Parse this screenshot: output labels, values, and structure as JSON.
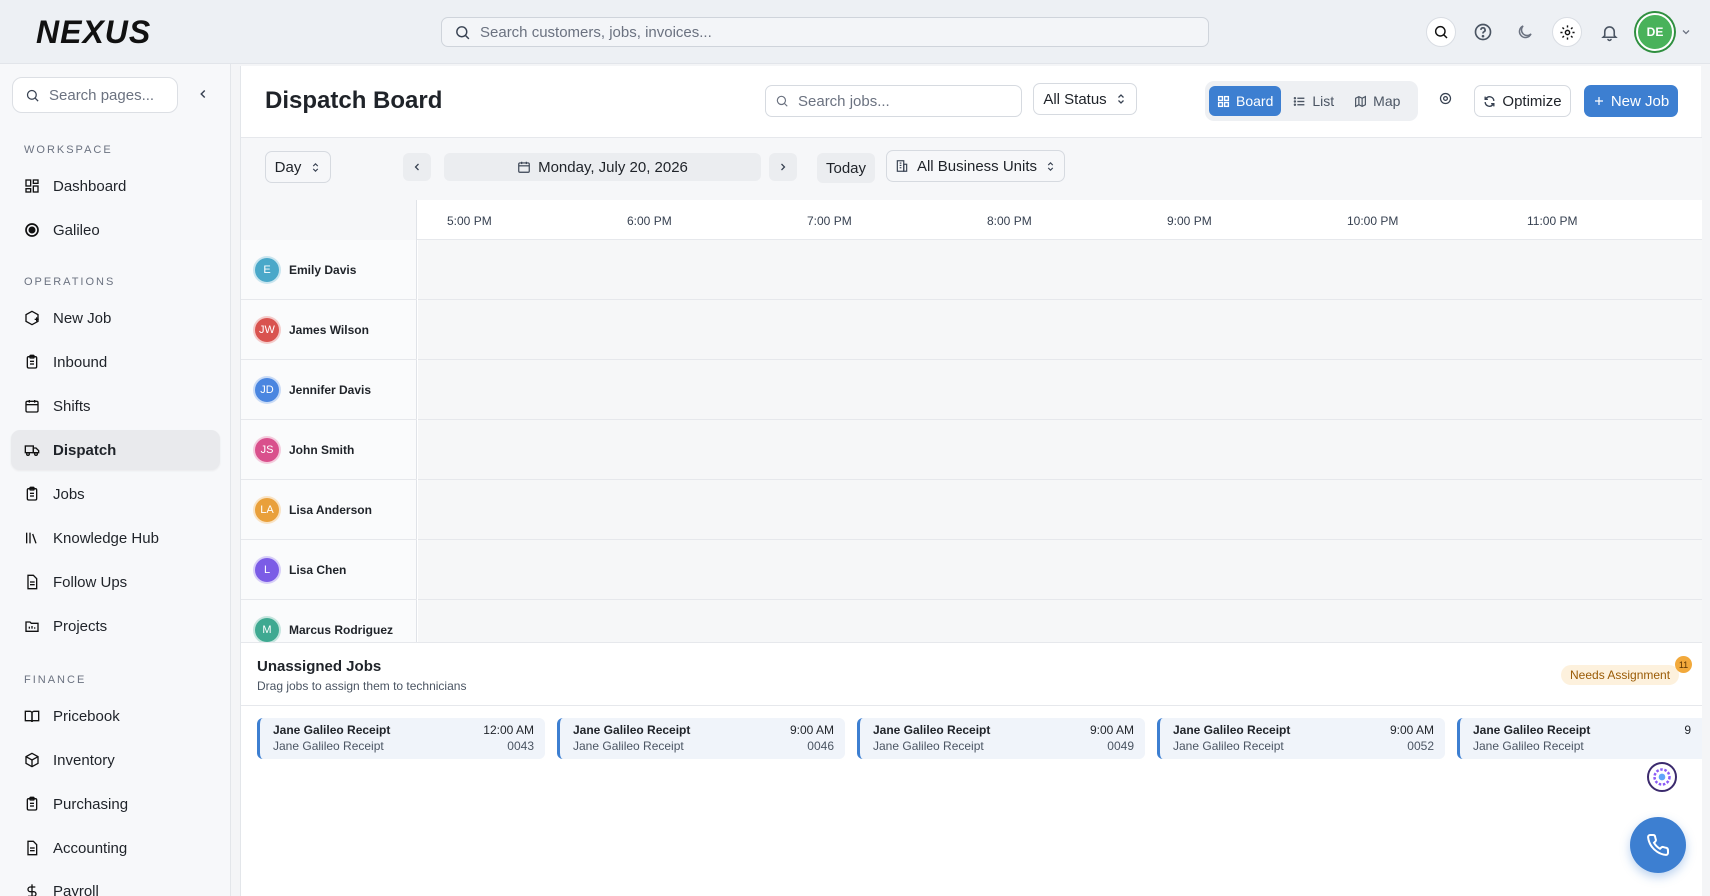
{
  "app": {
    "logo_text": "NEXUS"
  },
  "topbar": {
    "search_placeholder": "Search customers, jobs, invoices...",
    "user_initials": "DE"
  },
  "sidebar": {
    "search_placeholder": "Search pages...",
    "sections": [
      {
        "label": "WORKSPACE",
        "items": [
          {
            "label": "Dashboard",
            "icon": "dashboard-icon"
          },
          {
            "label": "Galileo",
            "icon": "galileo-icon"
          }
        ]
      },
      {
        "label": "OPERATIONS",
        "items": [
          {
            "label": "New Job",
            "icon": "new-job-icon"
          },
          {
            "label": "Inbound",
            "icon": "inbound-icon"
          },
          {
            "label": "Shifts",
            "icon": "calendar-icon"
          },
          {
            "label": "Dispatch",
            "icon": "truck-icon",
            "active": true
          },
          {
            "label": "Jobs",
            "icon": "clipboard-icon"
          },
          {
            "label": "Knowledge Hub",
            "icon": "library-icon"
          },
          {
            "label": "Follow Ups",
            "icon": "file-icon"
          },
          {
            "label": "Projects",
            "icon": "folder-icon"
          }
        ]
      },
      {
        "label": "FINANCE",
        "items": [
          {
            "label": "Pricebook",
            "icon": "book-icon"
          },
          {
            "label": "Inventory",
            "icon": "box-icon"
          },
          {
            "label": "Purchasing",
            "icon": "clipboard-icon"
          },
          {
            "label": "Accounting",
            "icon": "file-icon"
          },
          {
            "label": "Payroll",
            "icon": "dollar-icon"
          }
        ]
      }
    ]
  },
  "header": {
    "title": "Dispatch Board",
    "job_search_placeholder": "Search jobs...",
    "status_select": "All Status",
    "views": [
      "Board",
      "List",
      "Map"
    ],
    "active_view": "Board",
    "optimize_label": "Optimize",
    "new_job_label": "New Job"
  },
  "controls": {
    "range_select": "Day",
    "date": "Monday, July 20, 2026",
    "today_label": "Today",
    "business_units": "All Business Units"
  },
  "timeline": {
    "hours": [
      "5:00 PM",
      "6:00 PM",
      "7:00 PM",
      "8:00 PM",
      "9:00 PM",
      "10:00 PM",
      "11:00 PM"
    ],
    "technicians": [
      {
        "initials": "E",
        "name": "Emily Davis",
        "color": "#4aa8c9"
      },
      {
        "initials": "JW",
        "name": "James Wilson",
        "color": "#d9534f"
      },
      {
        "initials": "JD",
        "name": "Jennifer Davis",
        "color": "#4a86e0"
      },
      {
        "initials": "JS",
        "name": "John Smith",
        "color": "#d9508c"
      },
      {
        "initials": "LA",
        "name": "Lisa Anderson",
        "color": "#e9a03b"
      },
      {
        "initials": "L",
        "name": "Lisa Chen",
        "color": "#7b5ce6"
      },
      {
        "initials": "M",
        "name": "Marcus Rodriguez",
        "color": "#3fa991"
      }
    ]
  },
  "unassigned": {
    "title": "Unassigned Jobs",
    "subtitle": "Drag jobs to assign them to technicians",
    "badge": "Needs Assignment",
    "count": "11",
    "jobs": [
      {
        "title": "Jane Galileo Receipt",
        "time": "12:00 AM",
        "customer": "Jane Galileo Receipt",
        "number": "0043"
      },
      {
        "title": "Jane Galileo Receipt",
        "time": "9:00 AM",
        "customer": "Jane Galileo Receipt",
        "number": "0046"
      },
      {
        "title": "Jane Galileo Receipt",
        "time": "9:00 AM",
        "customer": "Jane Galileo Receipt",
        "number": "0049"
      },
      {
        "title": "Jane Galileo Receipt",
        "time": "9:00 AM",
        "customer": "Jane Galileo Receipt",
        "number": "0052"
      },
      {
        "title": "Jane Galileo Receipt",
        "time": "9",
        "customer": "Jane Galileo Receipt",
        "number": ""
      }
    ]
  },
  "colors": {
    "accent": "#3d7fd1",
    "badge_bg": "#fdf1dd",
    "badge_text": "#9a5b06"
  }
}
